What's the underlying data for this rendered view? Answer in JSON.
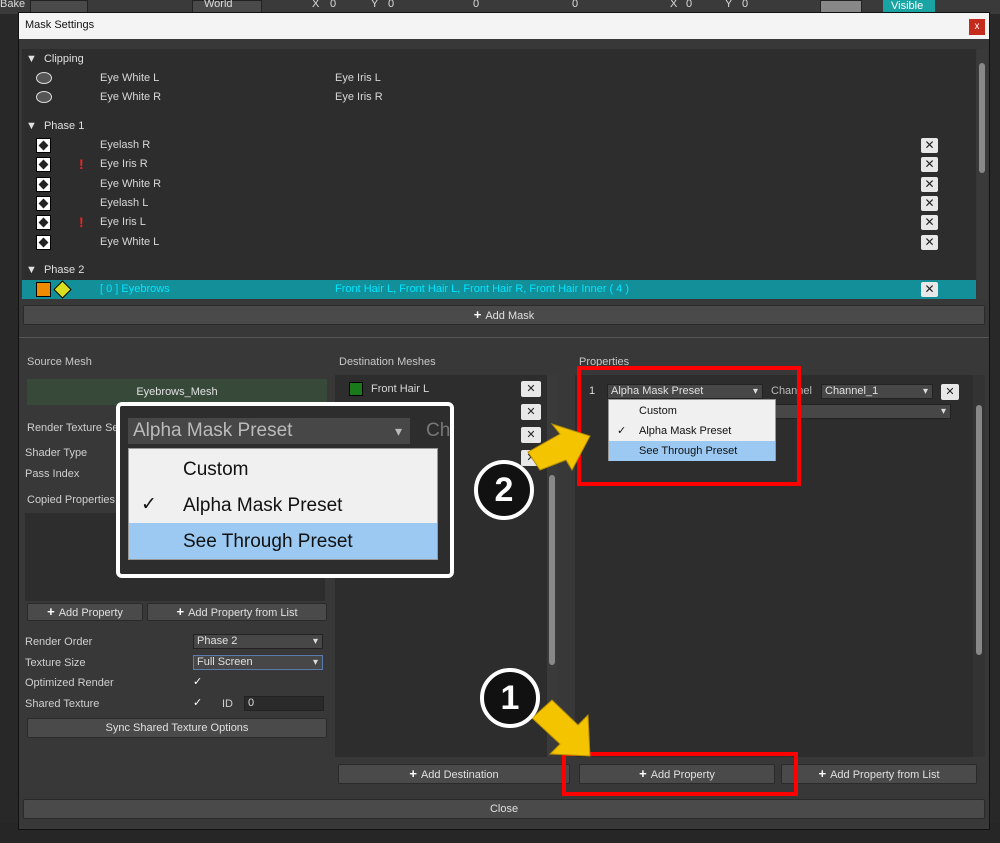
{
  "app_toolbar": {
    "bake_label": "Bake",
    "space_label": "World",
    "pos_x_label": "X",
    "pos_x_value": "0",
    "pos_y_label": "Y",
    "pos_y_value": "0",
    "scale_value": "0",
    "rot_value": "0",
    "size_x_label": "X",
    "size_x_value": "0",
    "size_y_label": "Y",
    "size_y_value": "0",
    "visible_label": "Visible"
  },
  "window": {
    "title": "Mask Settings",
    "close_glyph": "x"
  },
  "mask_list": {
    "groups": [
      {
        "name": "Clipping",
        "rows": [
          {
            "name": "Eye White L",
            "target": "Eye Iris L"
          },
          {
            "name": "Eye White R",
            "target": "Eye Iris R"
          }
        ]
      },
      {
        "name": "Phase 1",
        "rows": [
          {
            "name": "Eyelash R",
            "warn": false
          },
          {
            "name": "Eye Iris R",
            "warn": true
          },
          {
            "name": "Eye White R",
            "warn": false
          },
          {
            "name": "Eyelash L",
            "warn": false
          },
          {
            "name": "Eye Iris L",
            "warn": true
          },
          {
            "name": "Eye White L",
            "warn": false
          }
        ]
      },
      {
        "name": "Phase 2",
        "rows": [
          {
            "name": "[ 0 ] Eyebrows",
            "target": "Front Hair L, Front Hair L, Front Hair R, Front Hair Inner ( 4 )"
          }
        ]
      }
    ],
    "collapse_glyph": "▼",
    "delete_glyph": "✕",
    "warn_glyph": "!",
    "add_mask_label": "Add Mask"
  },
  "source_mesh": {
    "header": "Source Mesh",
    "mesh_name": "Eyebrows_Mesh",
    "render_texture_label": "Render Texture Se",
    "shader_type_label": "Shader Type",
    "pass_index_label": "Pass Index",
    "copied_properties_label": "Copied Properties",
    "add_property_label": "Add Property",
    "add_property_from_list_label": "Add Property from List",
    "render_order_label": "Render Order",
    "render_order_value": "Phase 2",
    "texture_size_label": "Texture Size",
    "texture_size_value": "Full Screen",
    "optimized_render_label": "Optimized Render",
    "shared_texture_label": "Shared Texture",
    "id_label": "ID",
    "id_value": "0",
    "check_glyph": "✓",
    "sync_label": "Sync Shared Texture Options"
  },
  "destination": {
    "header": "Destination Meshes",
    "items": [
      "Front Hair L"
    ],
    "add_destination_label": "Add Destination"
  },
  "properties": {
    "header": "Properties",
    "row_index": "1",
    "preset_value": "Alpha Mask Preset",
    "channel_label": "Channel",
    "channel_value": "Channel_1",
    "options": [
      "Custom",
      "Alpha Mask Preset",
      "See Through Preset"
    ],
    "add_property_label": "Add Property",
    "add_property_from_list_label": "Add Property from List"
  },
  "zoom": {
    "selected_value": "Alpha Mask Preset",
    "peek_text": "Ch",
    "options": [
      "Custom",
      "Alpha Mask Preset",
      "See Through Preset"
    ]
  },
  "annotations": {
    "step1": "1",
    "step2": "2"
  },
  "footer": {
    "close_label": "Close"
  },
  "colors": {
    "selected_row": "#138f9a",
    "highlight_option": "#9bc9f2",
    "annotation_red": "#ff0000",
    "annotation_arrow": "#f5c400"
  }
}
